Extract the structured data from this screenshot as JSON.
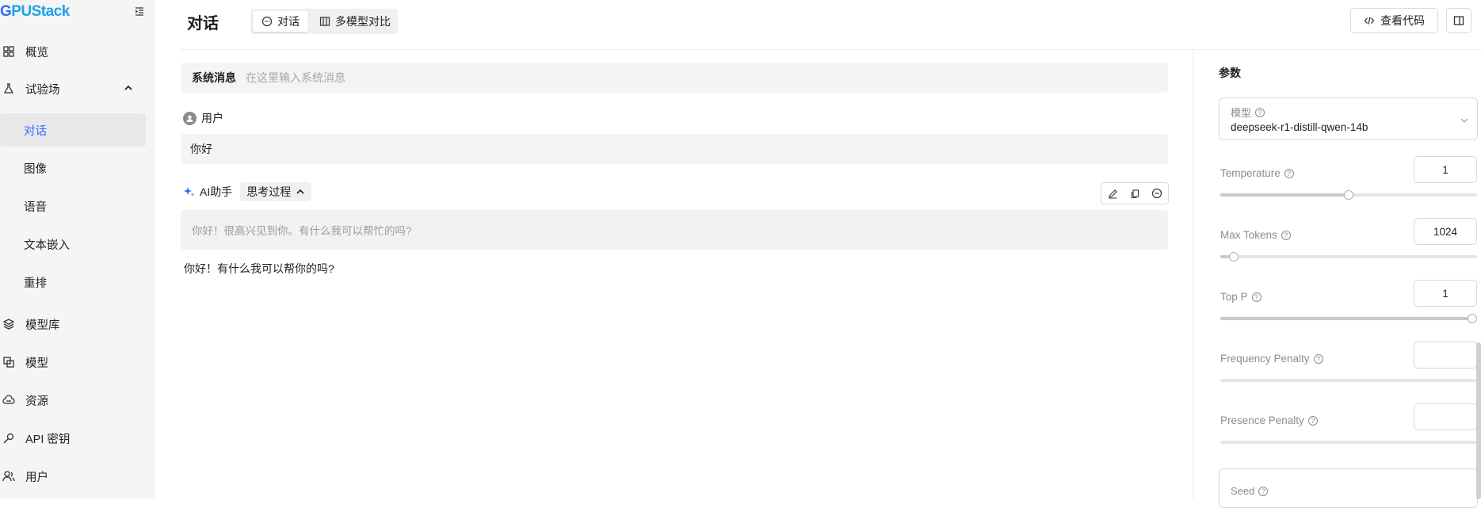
{
  "app": {
    "logo_part1": "G",
    "logo_part2": "PUStack"
  },
  "sidebar": {
    "items": [
      {
        "label": "概览",
        "icon": "dashboard-icon"
      },
      {
        "label": "试验场",
        "icon": "flask-icon",
        "expanded": true
      },
      {
        "label": "模型库",
        "icon": "layers-icon"
      },
      {
        "label": "模型",
        "icon": "models-icon"
      },
      {
        "label": "资源",
        "icon": "cloud-icon"
      },
      {
        "label": "API 密钥",
        "icon": "key-icon"
      },
      {
        "label": "用户",
        "icon": "users-icon"
      }
    ],
    "sub_items": [
      {
        "label": "对话",
        "active": true
      },
      {
        "label": "图像"
      },
      {
        "label": "语音"
      },
      {
        "label": "文本嵌入"
      },
      {
        "label": "重排"
      }
    ]
  },
  "header": {
    "title": "对话",
    "tabs": [
      {
        "label": "对话",
        "active": true
      },
      {
        "label": "多模型对比"
      }
    ],
    "view_code_label": "查看代码"
  },
  "chat": {
    "system_label": "系统消息",
    "system_placeholder": "在这里输入系统消息",
    "user_role": "用户",
    "user_message": "你好",
    "ai_role": "AI助手",
    "thinking_label": "思考过程",
    "thinking_text": "你好！很高兴见到你。有什么我可以帮忙的吗?",
    "ai_reply": "你好！有什么我可以帮你的吗?"
  },
  "params": {
    "title": "参数",
    "model_label": "模型",
    "model_value": "deepseek-r1-distill-qwen-14b",
    "temperature": {
      "label": "Temperature",
      "value": "1",
      "fraction": 0.5
    },
    "max_tokens": {
      "label": "Max Tokens",
      "value": "1024",
      "fraction": 0.052
    },
    "top_p": {
      "label": "Top P",
      "value": "1",
      "fraction": 1.0
    },
    "frequency_penalty": {
      "label": "Frequency Penalty",
      "value": ""
    },
    "presence_penalty": {
      "label": "Presence Penalty",
      "value": ""
    },
    "seed_label": "Seed"
  },
  "colors": {
    "accent": "#2f6bff",
    "sidebar_bg": "#f5f5f5"
  }
}
